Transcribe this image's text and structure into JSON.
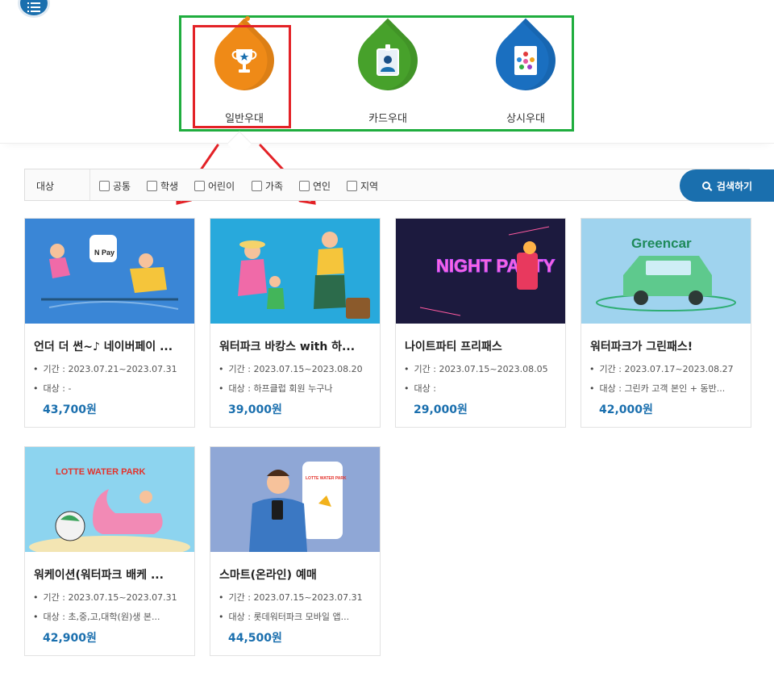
{
  "categories": [
    {
      "label": "일반우대",
      "icon": "trophy-icon",
      "color": "#ef8a17"
    },
    {
      "label": "카드우대",
      "icon": "id-card-icon",
      "color": "#47a12b"
    },
    {
      "label": "상시우대",
      "icon": "people-star-icon",
      "color": "#1a6fc0"
    }
  ],
  "filter": {
    "label": "대상",
    "options": [
      "공통",
      "학생",
      "어린이",
      "가족",
      "연인",
      "지역"
    ],
    "search_label": "검색하기"
  },
  "cards": [
    {
      "title": "언더 더 썬~♪ 네이버페이 ...",
      "period": "기간 : 2023.07.21~2023.07.31",
      "target": "대상 : -",
      "price": "43,700원",
      "thumb_text": "N Pay"
    },
    {
      "title": "워터파크 바캉스 with 하...",
      "period": "기간 : 2023.07.15~2023.08.20",
      "target": "대상 : 하프클럽 회원 누구나",
      "price": "39,000원",
      "thumb_text": ""
    },
    {
      "title": "나이트파티 프리패스",
      "period": "기간 : 2023.07.15~2023.08.05",
      "target": "대상 :",
      "price": "29,000원",
      "thumb_text": "NIGHT PARTY"
    },
    {
      "title": "워터파크가 그린패스!",
      "period": "기간 : 2023.07.17~2023.08.27",
      "target": "대상 : 그린카 고객 본인 + 동반...",
      "price": "42,000원",
      "thumb_text": "Greencar"
    },
    {
      "title": "워케이션(워터파크 배케 ...",
      "period": "기간 : 2023.07.15~2023.07.31",
      "target": "대상 : 초,중,고,대학(원)생 본...",
      "price": "42,900원",
      "thumb_text": "LOTTE WATER PARK"
    },
    {
      "title": "스마트(온라인) 예매",
      "period": "기간 : 2023.07.15~2023.07.31",
      "target": "대상 : 롯데워터파크 모바일 앱...",
      "price": "44,500원",
      "thumb_text": "LOTTE WATER PARK"
    }
  ]
}
